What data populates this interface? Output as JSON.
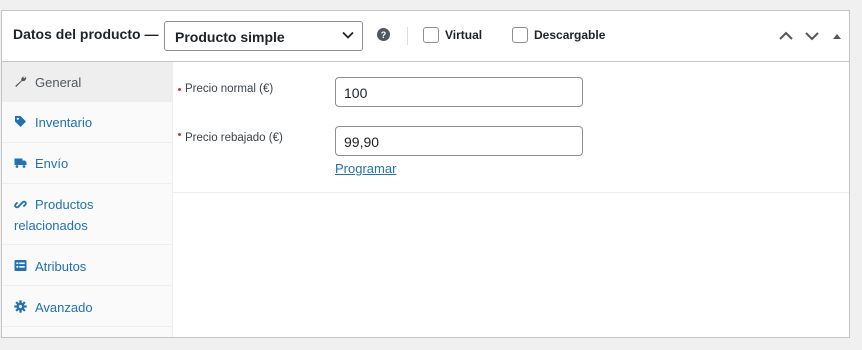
{
  "header": {
    "title": "Datos del producto —",
    "product_type": "Producto simple",
    "virtual_label": "Virtual",
    "downloadable_label": "Descargable"
  },
  "sidebar": {
    "items": [
      {
        "label": "General",
        "icon": "wrench-icon",
        "active": true
      },
      {
        "label": "Inventario",
        "icon": "tag-icon"
      },
      {
        "label": "Envío",
        "icon": "truck-icon"
      },
      {
        "label_line1": "Productos",
        "label_line2": "relacionados",
        "icon": "link-icon"
      },
      {
        "label": "Atributos",
        "icon": "list-icon"
      },
      {
        "label": "Avanzado",
        "icon": "gear-icon"
      }
    ]
  },
  "general": {
    "regular_price_label": "Precio normal (€)",
    "regular_price_value": "100",
    "sale_price_label": "Precio rebajado (€)",
    "sale_price_value": "99,90",
    "schedule_link": "Programar"
  },
  "colors": {
    "link": "#2271b1",
    "required": "#d63638",
    "border": "#c3c4c7"
  }
}
